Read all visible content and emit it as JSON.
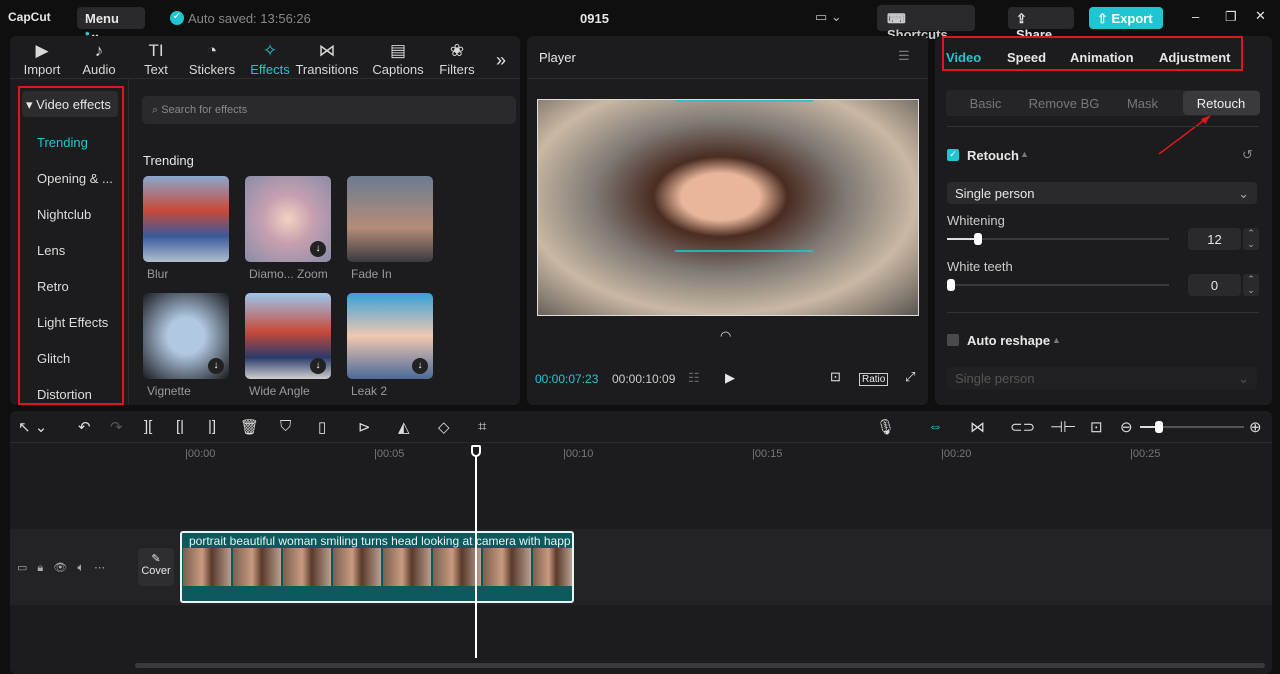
{
  "app": {
    "logo": "CapCut",
    "menu": "Menu",
    "autosave": "Auto saved: 13:56:26",
    "project": "0915",
    "shortcuts": "Shortcuts",
    "share": "Share",
    "export": "Export"
  },
  "toolbar_tabs": [
    {
      "label": "Import",
      "icon": "▶"
    },
    {
      "label": "Audio",
      "icon": "♪"
    },
    {
      "label": "Text",
      "icon": "TI"
    },
    {
      "label": "Stickers",
      "icon": "◔"
    },
    {
      "label": "Effects",
      "icon": "✧"
    },
    {
      "label": "Transitions",
      "icon": "⋈"
    },
    {
      "label": "Captions",
      "icon": "▤"
    },
    {
      "label": "Filters",
      "icon": "❀"
    }
  ],
  "sidebar": {
    "header": "Video effects",
    "items": [
      "Trending",
      "Opening & ...",
      "Nightclub",
      "Lens",
      "Retro",
      "Light Effects",
      "Glitch",
      "Distortion"
    ]
  },
  "search": {
    "placeholder": "Search for effects"
  },
  "effects": {
    "section": "Trending",
    "items": [
      "Blur",
      "Diamo... Zoom",
      "Fade In",
      "Vignette",
      "Wide Angle",
      "Leak 2"
    ]
  },
  "player": {
    "title": "Player",
    "current_time": "00:00:07:23",
    "total_time": "00:00:10:09",
    "ratio": "Ratio"
  },
  "inspector": {
    "tabs": [
      "Video",
      "Speed",
      "Animation",
      "Adjustment"
    ],
    "subtabs": [
      "Basic",
      "Remove BG",
      "Mask",
      "Retouch"
    ],
    "active_subtab": "Retouch",
    "retouch": {
      "label": "Retouch",
      "checked": true,
      "mode": "Single person",
      "whitening_label": "Whitening",
      "whitening": 12,
      "teeth_label": "White teeth",
      "teeth": 0
    },
    "auto_reshape": {
      "label": "Auto reshape",
      "checked": false,
      "mode": "Single person"
    }
  },
  "timeline": {
    "ticks": [
      "00:00",
      "00:05",
      "00:10",
      "00:15",
      "00:20",
      "00:25"
    ],
    "clip_title": "portrait beautiful woman smiling turns head looking at camera with happ",
    "cover": "Cover"
  },
  "colors": {
    "accent": "#1fc6d1",
    "annotation": "#e0161b"
  }
}
